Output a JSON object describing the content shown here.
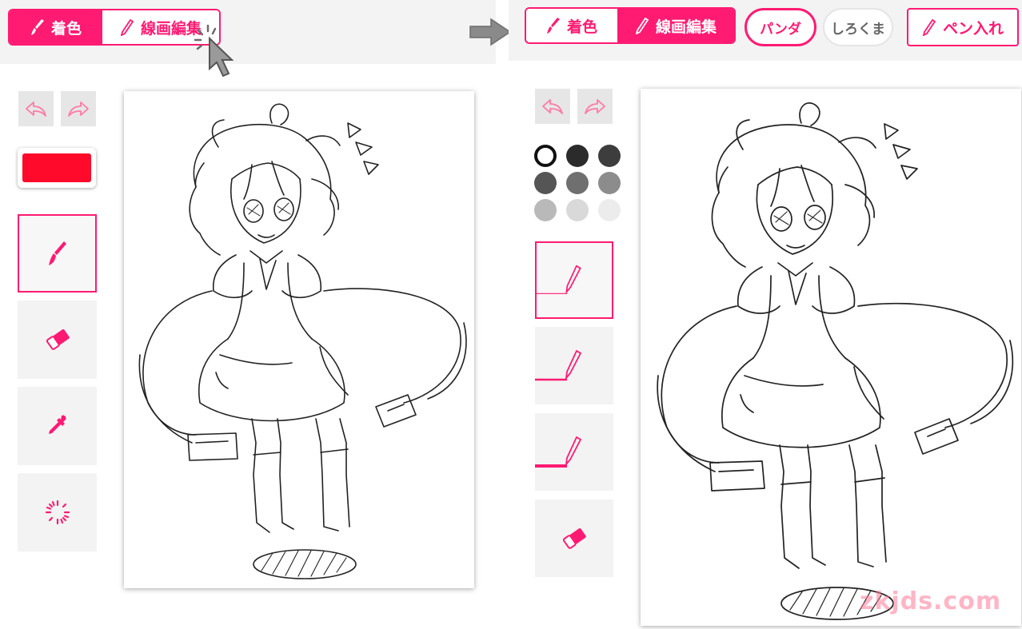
{
  "left_toolbar": {
    "coloring_label": "着色",
    "lineart_label": "線画編集"
  },
  "right_toolbar": {
    "coloring_label": "着色",
    "lineart_label": "線画編集",
    "brush_options": [
      "パンダ",
      "しろくま"
    ],
    "pen_label": "ペン入れ"
  },
  "left_panel": {
    "current_color": "#ff0a2a",
    "tools": [
      "brush-icon",
      "eraser-icon",
      "eyedropper-icon",
      "fill-icon"
    ]
  },
  "right_panel": {
    "palette": [
      "#ffffff",
      "#2b2b2b",
      "#3d3d3d",
      "#555555",
      "#6f6f6f",
      "#8c8c8c",
      "#b9b9b9",
      "#d9d9d9",
      "#ececec"
    ],
    "tools": [
      "pen-thin-icon",
      "pen-medium-icon",
      "pen-thick-icon",
      "eraser-icon"
    ]
  },
  "colors": {
    "accent": "#ff1a72"
  },
  "watermark": "zkjds.com"
}
